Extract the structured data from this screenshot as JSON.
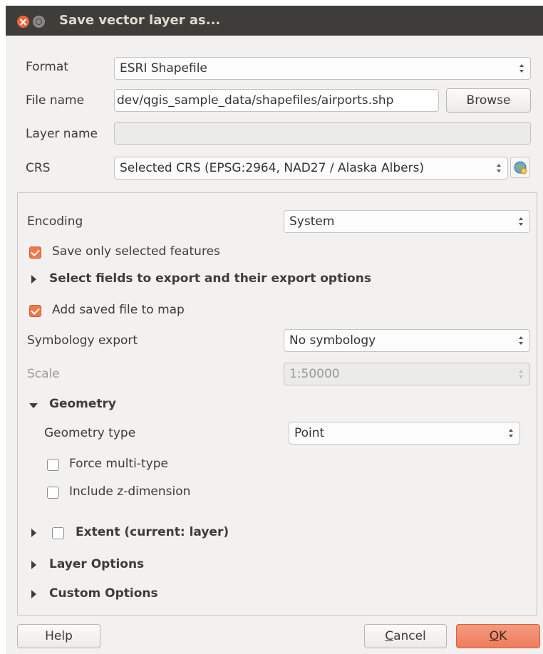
{
  "window": {
    "title": "Save vector layer as..."
  },
  "form": {
    "format_label": "Format",
    "format_value": "ESRI Shapefile",
    "filename_label": "File name",
    "filename_value": "dev/qgis_sample_data/shapefiles/airports.shp",
    "browse_label": "Browse",
    "layername_label": "Layer name",
    "layername_value": "",
    "crs_label": "CRS",
    "crs_value": "Selected CRS (EPSG:2964, NAD27 / Alaska Albers)"
  },
  "options": {
    "encoding_label": "Encoding",
    "encoding_value": "System",
    "save_selected_label": "Save only selected features",
    "save_selected_checked": true,
    "select_fields_label": "Select fields to export and their export options",
    "add_to_map_label": "Add saved file to map",
    "add_to_map_checked": true,
    "symbology_label": "Symbology export",
    "symbology_value": "No symbology",
    "scale_label": "Scale",
    "scale_value": "1:50000"
  },
  "geometry": {
    "section_label": "Geometry",
    "type_label": "Geometry type",
    "type_value": "Point",
    "force_multi_label": "Force multi-type",
    "force_multi_checked": false,
    "include_z_label": "Include z-dimension",
    "include_z_checked": false
  },
  "sections": {
    "extent_label": "Extent (current: layer)",
    "extent_checked": false,
    "layer_options_label": "Layer Options",
    "custom_options_label": "Custom Options"
  },
  "buttons": {
    "help": "Help",
    "cancel": "Cancel",
    "ok": "OK"
  },
  "colors": {
    "titlebar": "#3e3d39",
    "accent": "#f07746",
    "ok_button": "#ee7d5c"
  }
}
